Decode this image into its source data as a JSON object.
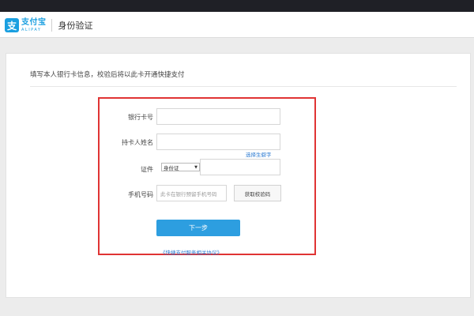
{
  "header": {
    "logo_glyph": "支",
    "logo_cn": "支付宝",
    "logo_en": "ALIPAY",
    "title": "身份验证"
  },
  "intro": "填写本人银行卡信息，校验后将以此卡开通快捷支付",
  "form": {
    "card_number_label": "银行卡号",
    "card_number_value": "",
    "holder_name_label": "持卡人姓名",
    "holder_name_value": "",
    "choose_card_link": "选择生僻字",
    "id_label": "证件",
    "id_type_selected": "身份证",
    "id_number_value": "",
    "phone_label": "手机号码",
    "phone_placeholder": "此卡在银行预留手机号码",
    "get_code_label": "获取校验码",
    "next_label": "下一步",
    "agreement_link": "《快捷支付服务相关协议》"
  },
  "colors": {
    "brand_blue": "#1a9fe0",
    "button_blue": "#2d9ee0",
    "highlight_red": "#e03434",
    "link_blue": "#2b7ad1"
  }
}
